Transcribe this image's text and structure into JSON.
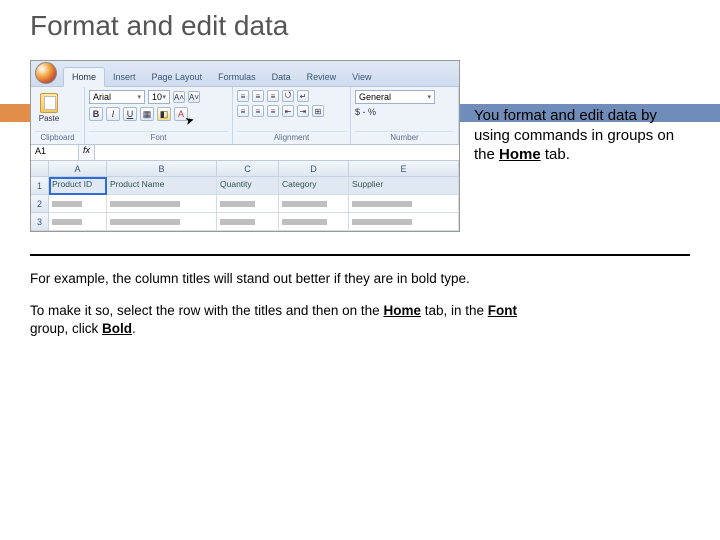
{
  "title": "Format and edit data",
  "excel": {
    "tabs": [
      "Home",
      "Insert",
      "Page Layout",
      "Formulas",
      "Data",
      "Review",
      "View"
    ],
    "active_tab": "Home",
    "groups": {
      "clipboard": "Clipboard",
      "font": "Font",
      "alignment": "Alignment",
      "number": "Number",
      "paste": "Paste"
    },
    "font_name": "Arial",
    "font_size": "10",
    "btn": {
      "bold": "B",
      "italic": "I",
      "underline": "U",
      "incfont": "A▲",
      "decfont": "A▼",
      "Aup": "A˄",
      "Adown": "A˅"
    },
    "namebox": "A1",
    "fx": "fx",
    "columns": [
      "A",
      "B",
      "C",
      "D",
      "E"
    ],
    "rows": [
      "1",
      "2",
      "3"
    ],
    "headers": [
      "Product ID",
      "Product Name",
      "Quantity",
      "Category",
      "Supplier"
    ],
    "number_fmt": "$ - %"
  },
  "sidetext_parts": {
    "p1": "You format and edit data by using commands in groups on the ",
    "p2": "Home",
    "p3": " tab."
  },
  "para1": "For example, the column titles will stand out better if they are in bold type.",
  "para2_parts": {
    "a": "To make it so, select the row with the titles and then on the ",
    "b": "Home",
    "c": " tab, in the ",
    "d": "Font",
    "e": " group, click ",
    "f": "Bold",
    "g": "."
  }
}
